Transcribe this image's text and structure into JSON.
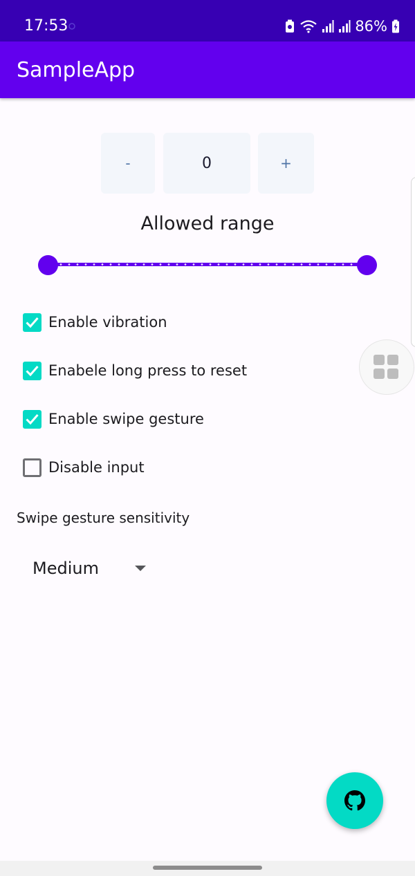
{
  "status_bar": {
    "time": "17:53",
    "battery": "86%",
    "icons": [
      "notification-dot-icon",
      "battery-saver-icon",
      "wifi-icon",
      "signal-icon",
      "signal-icon",
      "battery-icon"
    ]
  },
  "app_bar": {
    "title": "SampleApp"
  },
  "stepper": {
    "decrement_label": "-",
    "value": "0",
    "increment_label": "+"
  },
  "range": {
    "label": "Allowed range",
    "start_fraction": 0,
    "end_fraction": 1
  },
  "checkboxes": [
    {
      "label": "Enable vibration",
      "checked": true
    },
    {
      "label": "Enabele long press to reset",
      "checked": true
    },
    {
      "label": "Enable swipe gesture",
      "checked": true
    },
    {
      "label": "Disable input",
      "checked": false
    }
  ],
  "sensitivity": {
    "label": "Swipe gesture sensitivity",
    "selected": "Medium"
  },
  "fab": {
    "icon": "github-icon"
  },
  "overlay": {
    "icon": "grid-icon"
  },
  "colors": {
    "status_bar": "#3700b3",
    "primary": "#6200ee",
    "secondary": "#03dac5",
    "stepper_bg": "#f3f6fb",
    "stepper_text": "#4f74a6",
    "background": "#fefbff"
  }
}
